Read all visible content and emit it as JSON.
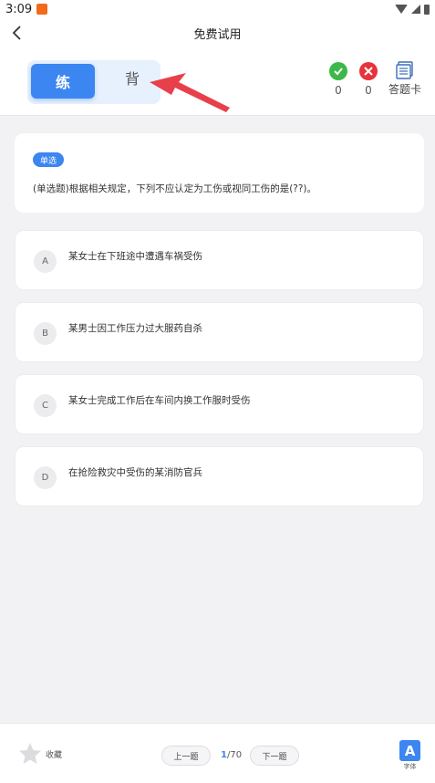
{
  "status_bar": {
    "time": "3:09"
  },
  "nav": {
    "title": "免费试用"
  },
  "mode": {
    "practice_label": "练",
    "memorize_label": "背"
  },
  "stats": {
    "correct_count": "0",
    "wrong_count": "0",
    "answer_card_label": "答题卡"
  },
  "question": {
    "type_badge": "单选",
    "text": "(单选题)根据相关规定，下列不应认定为工伤或视同工伤的是(??)。"
  },
  "options": [
    {
      "letter": "A",
      "text": "某女士在下班途中遭遇车祸受伤"
    },
    {
      "letter": "B",
      "text": "某男士因工作压力过大服药自杀"
    },
    {
      "letter": "C",
      "text": "某女士完成工作后在车间内换工作服时受伤"
    },
    {
      "letter": "D",
      "text": "在抢险救灾中受伤的某消防官兵"
    }
  ],
  "bottom": {
    "favorite_label": "收藏",
    "prev_label": "上一题",
    "next_label": "下一题",
    "current_page": "1",
    "total_pages": "/70",
    "font_icon_letter": "A",
    "font_label": "字体"
  },
  "colors": {
    "accent": "#3b86f0",
    "correct": "#3cb84a",
    "wrong": "#e8323c",
    "annotation_arrow": "#e8404a"
  }
}
